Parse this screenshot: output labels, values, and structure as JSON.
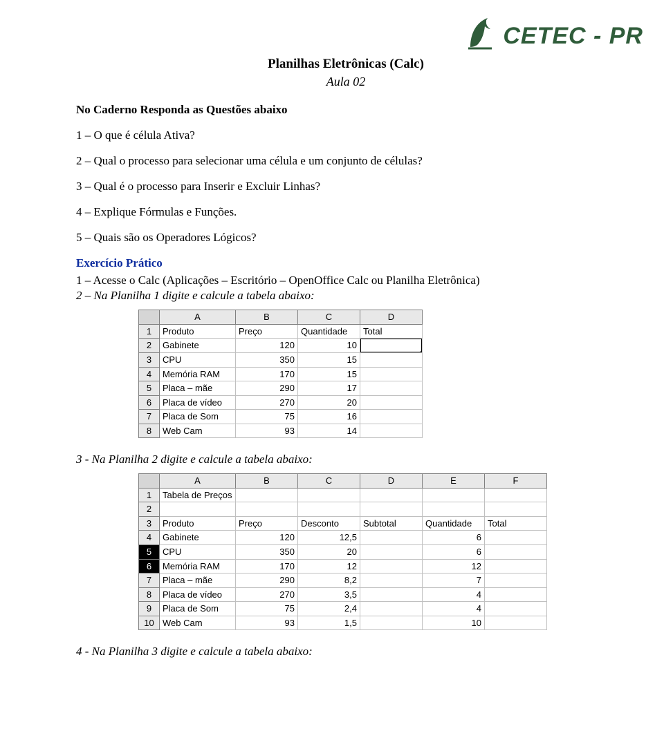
{
  "logo": {
    "text": "CETEC - PR"
  },
  "title": {
    "main": "Planilhas Eletrônicas (Calc)",
    "sub": "Aula 02"
  },
  "heading": "No Caderno Responda as Questões abaixo",
  "questions": [
    "1 – O que é célula Ativa?",
    "2 – Qual o processo para selecionar uma célula e um conjunto de células?",
    "3 – Qual é o processo para Inserir e Excluir Linhas?",
    "4 – Explique Fórmulas e Funções.",
    "5 – Quais são os Operadores Lógicos?"
  ],
  "exercise": {
    "heading": "Exercício Prático",
    "line1": "1 – Acesse o Calc (Aplicações – Escritório – OpenOffice Calc ou Planilha Eletrônica)",
    "line2": "2 – Na Planilha 1 digite e calcule a tabela abaixo:"
  },
  "table1": {
    "cols": [
      "A",
      "B",
      "C",
      "D"
    ],
    "widths": [
      30,
      110,
      90,
      90,
      90
    ],
    "rows": [
      {
        "n": "1",
        "c": [
          "Produto",
          "Preço",
          "Quantidade",
          "Total"
        ],
        "align": [
          "txt",
          "txt",
          "txt",
          "txt"
        ]
      },
      {
        "n": "2",
        "c": [
          "Gabinete",
          "120",
          "10",
          ""
        ],
        "align": [
          "txt",
          "num",
          "num",
          "sel"
        ]
      },
      {
        "n": "3",
        "c": [
          "CPU",
          "350",
          "15",
          ""
        ],
        "align": [
          "txt",
          "num",
          "num",
          "txt"
        ]
      },
      {
        "n": "4",
        "c": [
          "Memória RAM",
          "170",
          "15",
          ""
        ],
        "align": [
          "txt",
          "num",
          "num",
          "txt"
        ]
      },
      {
        "n": "5",
        "c": [
          "Placa – mãe",
          "290",
          "17",
          ""
        ],
        "align": [
          "txt",
          "num",
          "num",
          "txt"
        ]
      },
      {
        "n": "6",
        "c": [
          "Placa de vídeo",
          "270",
          "20",
          ""
        ],
        "align": [
          "txt",
          "num",
          "num",
          "txt"
        ]
      },
      {
        "n": "7",
        "c": [
          "Placa de Som",
          "75",
          "16",
          ""
        ],
        "align": [
          "txt",
          "num",
          "num",
          "txt"
        ]
      },
      {
        "n": "8",
        "c": [
          "Web Cam",
          "93",
          "14",
          ""
        ],
        "align": [
          "txt",
          "num",
          "num",
          "txt"
        ]
      }
    ]
  },
  "step3": "3 - Na Planilha 2 digite e calcule a tabela abaixo:",
  "table2": {
    "cols": [
      "A",
      "B",
      "C",
      "D",
      "E",
      "F"
    ],
    "widths": [
      30,
      110,
      90,
      90,
      90,
      90,
      90
    ],
    "rows": [
      {
        "n": "1",
        "c": [
          "Tabela de Preços",
          "",
          "",
          "",
          "",
          ""
        ],
        "align": [
          "txt",
          "txt",
          "txt",
          "txt",
          "txt",
          "txt"
        ]
      },
      {
        "n": "2",
        "c": [
          "",
          "",
          "",
          "",
          "",
          ""
        ],
        "align": [
          "txt",
          "txt",
          "txt",
          "txt",
          "txt",
          "txt"
        ]
      },
      {
        "n": "3",
        "c": [
          "Produto",
          "Preço",
          "Desconto",
          "Subtotal",
          "Quantidade",
          "Total"
        ],
        "align": [
          "txt",
          "txt",
          "txt",
          "txt",
          "txt",
          "txt"
        ]
      },
      {
        "n": "4",
        "c": [
          "Gabinete",
          "120",
          "12,5",
          "",
          "6",
          ""
        ],
        "align": [
          "txt",
          "num",
          "num",
          "txt",
          "num",
          "txt"
        ]
      },
      {
        "n": "5",
        "sel": true,
        "c": [
          "CPU",
          "350",
          "20",
          "",
          "6",
          ""
        ],
        "align": [
          "txt",
          "num",
          "num",
          "txt",
          "num",
          "txt"
        ]
      },
      {
        "n": "6",
        "sel": true,
        "c": [
          "Memória RAM",
          "170",
          "12",
          "",
          "12",
          ""
        ],
        "align": [
          "txt",
          "num",
          "num",
          "txt",
          "num",
          "txt"
        ]
      },
      {
        "n": "7",
        "c": [
          "Placa – mãe",
          "290",
          "8,2",
          "",
          "7",
          ""
        ],
        "align": [
          "txt",
          "num",
          "num",
          "txt",
          "num",
          "txt"
        ]
      },
      {
        "n": "8",
        "c": [
          "Placa de vídeo",
          "270",
          "3,5",
          "",
          "4",
          ""
        ],
        "align": [
          "txt",
          "num",
          "num",
          "txt",
          "num",
          "txt"
        ]
      },
      {
        "n": "9",
        "c": [
          "Placa de Som",
          "75",
          "2,4",
          "",
          "4",
          ""
        ],
        "align": [
          "txt",
          "num",
          "num",
          "txt",
          "num",
          "txt"
        ]
      },
      {
        "n": "10",
        "c": [
          "Web Cam",
          "93",
          "1,5",
          "",
          "10",
          ""
        ],
        "align": [
          "txt",
          "num",
          "num",
          "txt",
          "num",
          "txt"
        ]
      }
    ]
  },
  "step4": "4 - Na Planilha 3 digite e calcule a tabela abaixo:"
}
